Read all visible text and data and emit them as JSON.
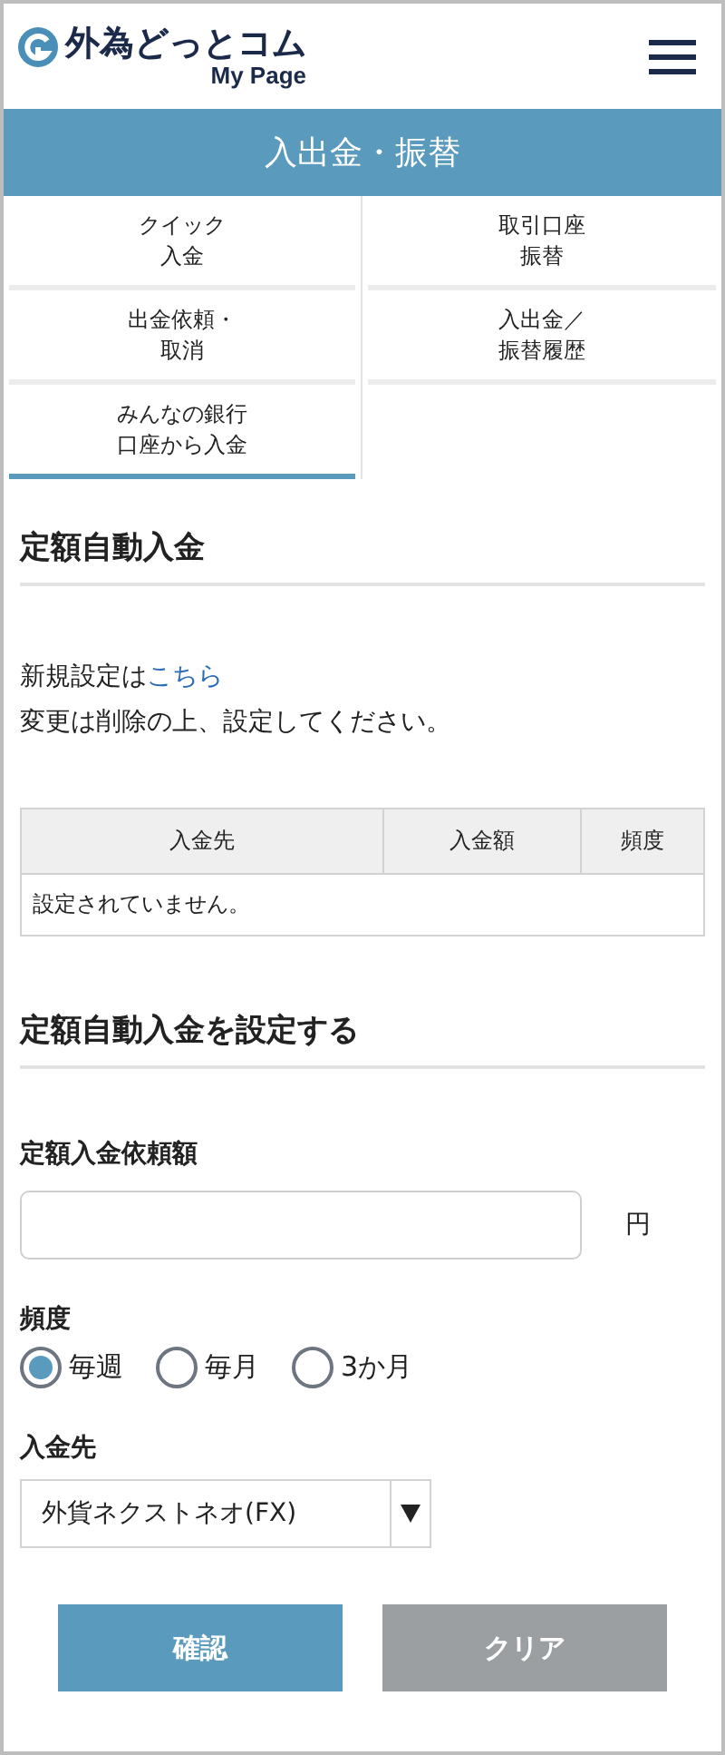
{
  "header": {
    "logo_text": "外為どっとコム",
    "logo_subtext": "My Page"
  },
  "title_bar": {
    "title": "入出金・振替"
  },
  "nav": [
    {
      "label": "クイック入金",
      "selected": false
    },
    {
      "label": "取引口座振替",
      "selected": false
    },
    {
      "label": "出金依頼・取消",
      "selected": false
    },
    {
      "label": "入出金／振替履歴",
      "selected": false
    },
    {
      "label": "みんなの銀行口座から入金",
      "selected": true
    }
  ],
  "list_section": {
    "heading": "定額自動入金",
    "intro": "新規設定は",
    "link": "こちら",
    "note": "変更は削除の上、設定してください。",
    "table": {
      "columns": [
        "入金先",
        "入金額",
        "頻度"
      ],
      "empty_message": "設定されていません。"
    }
  },
  "form_section": {
    "heading": "定額自動入金を設定する",
    "amount": {
      "label": "定額入金依頼額",
      "unit": "円"
    },
    "frequency": {
      "label": "頻度",
      "options": [
        {
          "label": "毎週",
          "selected": true
        },
        {
          "label": "毎月",
          "selected": false
        },
        {
          "label": "3か月",
          "selected": false
        }
      ]
    },
    "destination": {
      "label": "入金先",
      "value": "外貨ネクストネオ(FX)"
    },
    "buttons": [
      {
        "label": "確認",
        "kind": "primary"
      },
      {
        "label": "クリア",
        "kind": "secondary"
      }
    ]
  }
}
